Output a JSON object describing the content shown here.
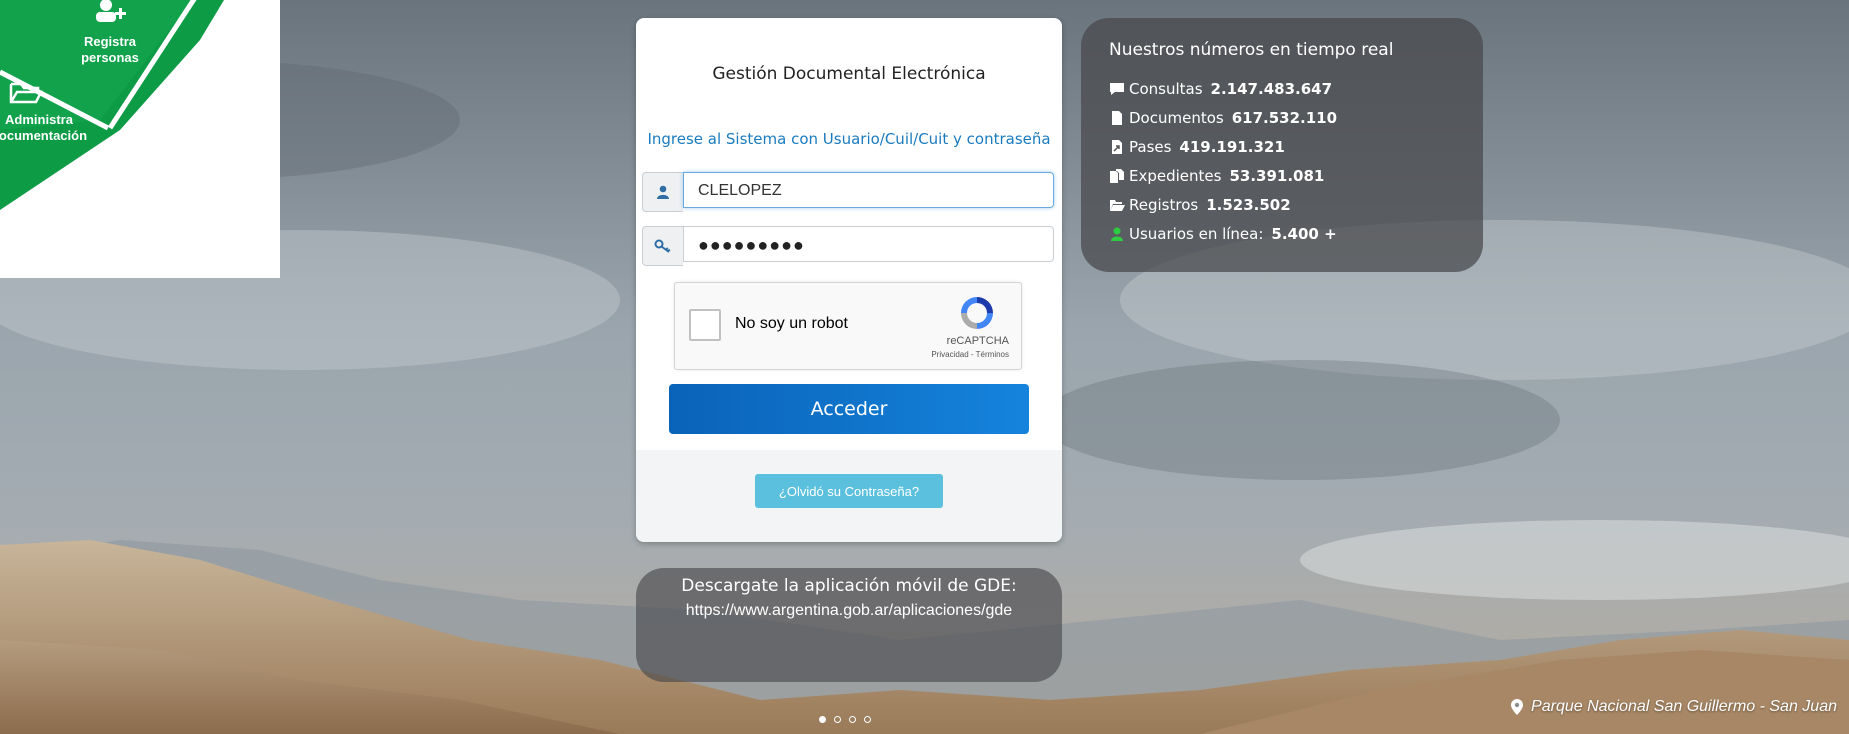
{
  "logo": {
    "segments": [
      {
        "label": "Registra\npersonas",
        "icon": "person-add-icon"
      },
      {
        "label": "Administra\ndocumentación",
        "icon": "folder-open-icon"
      }
    ],
    "brand_color": "#0d9b46"
  },
  "login": {
    "title": "Gestión Documental Electrónica",
    "subtitle": "Ingrese al Sistema con Usuario/Cuil/Cuit y contraseña",
    "username_value": "CLELOPEZ",
    "password_value": "●●●●●●●●●",
    "captcha": {
      "label": "No soy un robot",
      "brand": "reCAPTCHA",
      "links": "Privacidad - Términos"
    },
    "submit_label": "Acceder",
    "forgot_label": "¿Olvidó su Contraseña?",
    "accent_color": "#1583dc"
  },
  "stats": {
    "title": "Nuestros números en tiempo real",
    "items": [
      {
        "icon": "comment-icon",
        "label": "Consultas",
        "value": "2.147.483.647"
      },
      {
        "icon": "file-icon",
        "label": "Documentos",
        "value": "617.532.110"
      },
      {
        "icon": "file-export-icon",
        "label": "Pases",
        "value": "419.191.321"
      },
      {
        "icon": "files-icon",
        "label": "Expedientes",
        "value": "53.391.081"
      },
      {
        "icon": "folder-open-icon",
        "label": "Registros",
        "value": "1.523.502"
      },
      {
        "icon": "user-online-icon",
        "label": "Usuarios en línea:",
        "value": "5.400 +"
      }
    ]
  },
  "app_download": {
    "line1": "Descargate la aplicación móvil de GDE:",
    "line2": "https://www.argentina.gob.ar/aplicaciones/gde"
  },
  "carousel": {
    "count": 4,
    "active": 1
  },
  "location": {
    "icon": "map-marker-icon",
    "text": "Parque Nacional San Guillermo - San Juan"
  }
}
